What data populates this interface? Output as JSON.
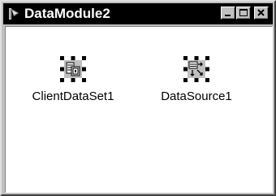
{
  "window": {
    "title": "DataModule2"
  },
  "titlebar_buttons": {
    "minimize": "minimize",
    "maximize": "maximize",
    "close": "close"
  },
  "components": [
    {
      "name": "ClientDataSet1",
      "icon": "client-dataset-icon"
    },
    {
      "name": "DataSource1",
      "icon": "datasource-icon"
    }
  ],
  "colors": {
    "titlebar": "#000000",
    "title_text": "#ffffff",
    "chrome": "#c0c0c0",
    "client_bg": "#ffffff",
    "selection_handles": "#000000"
  }
}
